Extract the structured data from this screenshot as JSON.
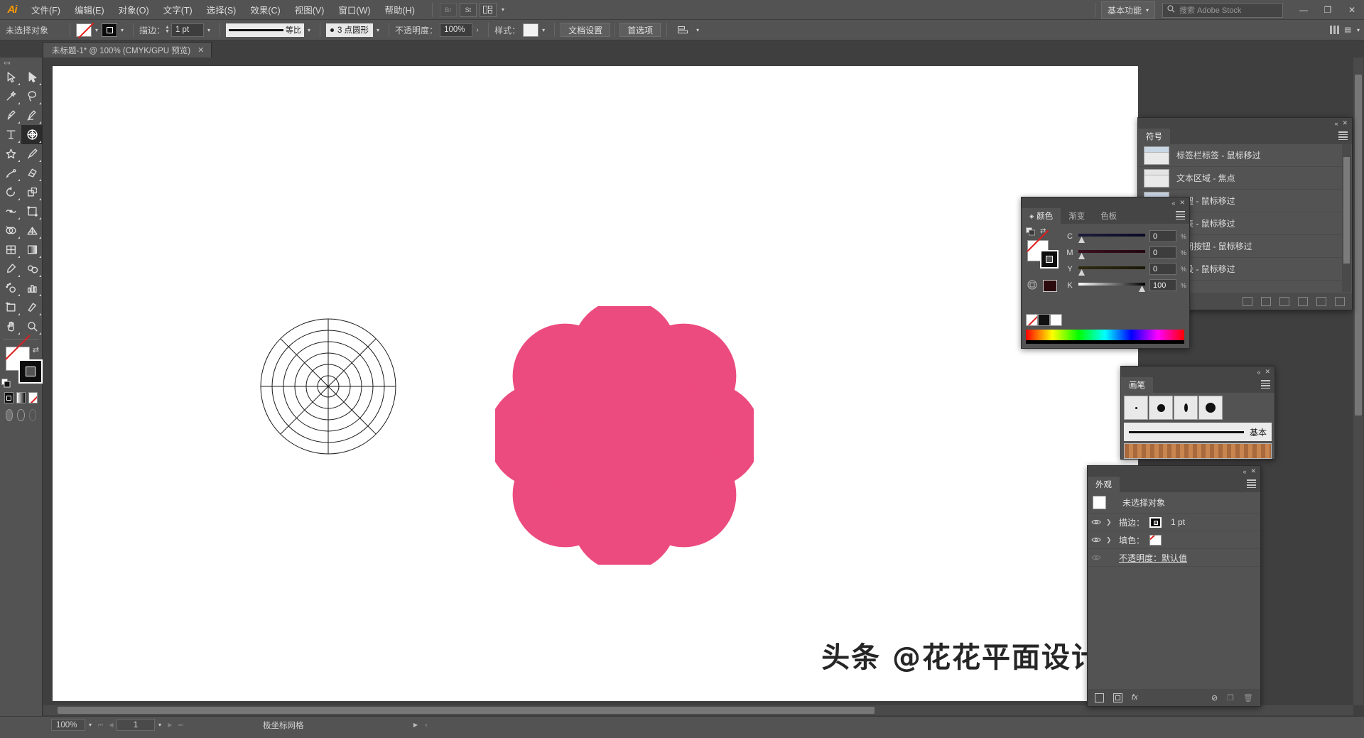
{
  "app": {
    "name": "Adobe Illustrator",
    "logo": "Ai"
  },
  "menu": {
    "items": [
      {
        "label": "文件(F)"
      },
      {
        "label": "编辑(E)"
      },
      {
        "label": "对象(O)"
      },
      {
        "label": "文字(T)"
      },
      {
        "label": "选择(S)"
      },
      {
        "label": "效果(C)"
      },
      {
        "label": "视图(V)"
      },
      {
        "label": "窗口(W)"
      },
      {
        "label": "帮助(H)"
      }
    ],
    "bridge_label": "Br",
    "stock_label": "St",
    "arrange_icon": "arrange-documents-icon",
    "workspace": "基本功能",
    "search_placeholder": "搜索 Adobe Stock",
    "window_controls": {
      "minimize": "—",
      "maximize": "❐",
      "close": "✕"
    }
  },
  "control_bar": {
    "selection_status": "未选择对象",
    "fill_swatch": "none",
    "stroke_swatch": "black-inner",
    "stroke_label": "描边：",
    "stroke_weight": "1 pt",
    "profile_label": "等比",
    "brush_label": "3 点圆形",
    "opacity_label": "不透明度：",
    "opacity_value": "100%",
    "style_label": "样式：",
    "doc_setup": "文档设置",
    "preferences": "首选项",
    "align_icon": "align-objects-icon"
  },
  "tab": {
    "title": "未标题-1* @ 100% (CMYK/GPU 预览)",
    "close": "✕"
  },
  "toolbar": {
    "tools": [
      {
        "name": "selection-tool",
        "icon": "cursor-outline"
      },
      {
        "name": "direct-selection-tool",
        "icon": "cursor-solid"
      },
      {
        "name": "magic-wand-tool",
        "icon": "wand"
      },
      {
        "name": "lasso-tool",
        "icon": "lasso"
      },
      {
        "name": "pen-tool",
        "icon": "pen"
      },
      {
        "name": "curvature-tool",
        "icon": "curvature"
      },
      {
        "name": "type-tool",
        "icon": "type-T"
      },
      {
        "name": "line-segment-tool",
        "icon": "polar-grid",
        "selected": true
      },
      {
        "name": "shape-tool",
        "icon": "star"
      },
      {
        "name": "paintbrush-tool",
        "icon": "brush"
      },
      {
        "name": "pencil-tool",
        "icon": "pencil-shaper"
      },
      {
        "name": "eraser-tool",
        "icon": "eraser"
      },
      {
        "name": "rotate-tool",
        "icon": "rotate"
      },
      {
        "name": "scale-tool",
        "icon": "scale"
      },
      {
        "name": "width-tool",
        "icon": "width-warp"
      },
      {
        "name": "free-transform-tool",
        "icon": "free-transform"
      },
      {
        "name": "shape-builder-tool",
        "icon": "shape-builder"
      },
      {
        "name": "perspective-grid-tool",
        "icon": "perspective-grid"
      },
      {
        "name": "mesh-tool",
        "icon": "mesh"
      },
      {
        "name": "gradient-tool",
        "icon": "gradient"
      },
      {
        "name": "eyedropper-tool",
        "icon": "eyedropper"
      },
      {
        "name": "blend-tool",
        "icon": "blend"
      },
      {
        "name": "symbol-sprayer-tool",
        "icon": "symbol-sprayer"
      },
      {
        "name": "column-graph-tool",
        "icon": "bar-chart"
      },
      {
        "name": "artboard-tool",
        "icon": "artboard"
      },
      {
        "name": "slice-tool",
        "icon": "slice-knife"
      },
      {
        "name": "hand-tool",
        "icon": "hand"
      },
      {
        "name": "zoom-tool",
        "icon": "magnifier"
      }
    ],
    "fill_stroke": {
      "fill": "none",
      "stroke": "black",
      "swap": "swap-fill-stroke-icon",
      "defaults": "default-fill-stroke-icon"
    },
    "color_modes": [
      {
        "name": "color-mode-button",
        "icon": "solid-color"
      },
      {
        "name": "gradient-mode-button",
        "icon": "gradient"
      },
      {
        "name": "none-mode-button",
        "icon": "none"
      }
    ],
    "screen_modes": [
      {
        "name": "drawing-mode-normal"
      },
      {
        "name": "drawing-mode-behind"
      },
      {
        "name": "screen-mode-button"
      }
    ]
  },
  "canvas": {
    "polar_grid": {
      "name": "极坐标网格",
      "rings": 6,
      "dividers": 4,
      "stroke": "#1a1a1a"
    },
    "flower": {
      "name": "flower-shape",
      "petals": 8,
      "fill": "#ec4b80"
    },
    "watermark": "头条 @花花平面设计"
  },
  "panels": {
    "symbols": {
      "title": "符号",
      "items": [
        {
          "label": "标签栏标签 - 鼠标移过"
        },
        {
          "label": "文本区域 - 焦点"
        },
        {
          "label": "按钮 - 鼠标移过"
        },
        {
          "label": "列表 - 鼠标移过"
        },
        {
          "label": "关闭按钮 - 鼠标移过"
        },
        {
          "label": "字段 - 鼠标移过"
        }
      ],
      "collapse": "«",
      "close": "✕",
      "menu": "panel-menu-icon"
    },
    "color": {
      "tabs": [
        {
          "label": "颜色",
          "active": true
        },
        {
          "label": "渐变",
          "active": false
        },
        {
          "label": "色板",
          "active": false
        }
      ],
      "sliders": [
        {
          "label": "C",
          "value": "0",
          "unit": "%"
        },
        {
          "label": "M",
          "value": "0",
          "unit": "%"
        },
        {
          "label": "Y",
          "value": "0",
          "unit": "%"
        },
        {
          "label": "K",
          "value": "100",
          "unit": "%"
        }
      ],
      "collapse": "«",
      "close": "✕"
    },
    "brushes": {
      "title": "画笔",
      "basic_label": "基本",
      "collapse": "«",
      "close": "✕"
    },
    "appearance": {
      "title": "外观",
      "object_label": "未选择对象",
      "rows": [
        {
          "label": "描边：",
          "value": "1 pt",
          "swatch": "black",
          "visible": true
        },
        {
          "label": "填色：",
          "value": "",
          "swatch": "none",
          "visible": true
        }
      ],
      "opacity_row": {
        "label": "不透明度：默认值",
        "visible": false
      },
      "footer": {
        "add_stroke": "add-new-stroke-icon",
        "add_fill": "add-new-fill-icon",
        "fx": "fx",
        "clear": "clear-appearance-icon",
        "duplicate": "duplicate-item-icon",
        "delete": "delete-item-icon"
      },
      "collapse": "«",
      "close": "✕"
    }
  },
  "status_bar": {
    "zoom": "100%",
    "artboard_first": "⏮",
    "artboard_prev": "◀",
    "artboard_number": "1",
    "artboard_next": "▶",
    "artboard_last": "⏭",
    "current_tool": "极坐标网格",
    "expand": "▶"
  }
}
